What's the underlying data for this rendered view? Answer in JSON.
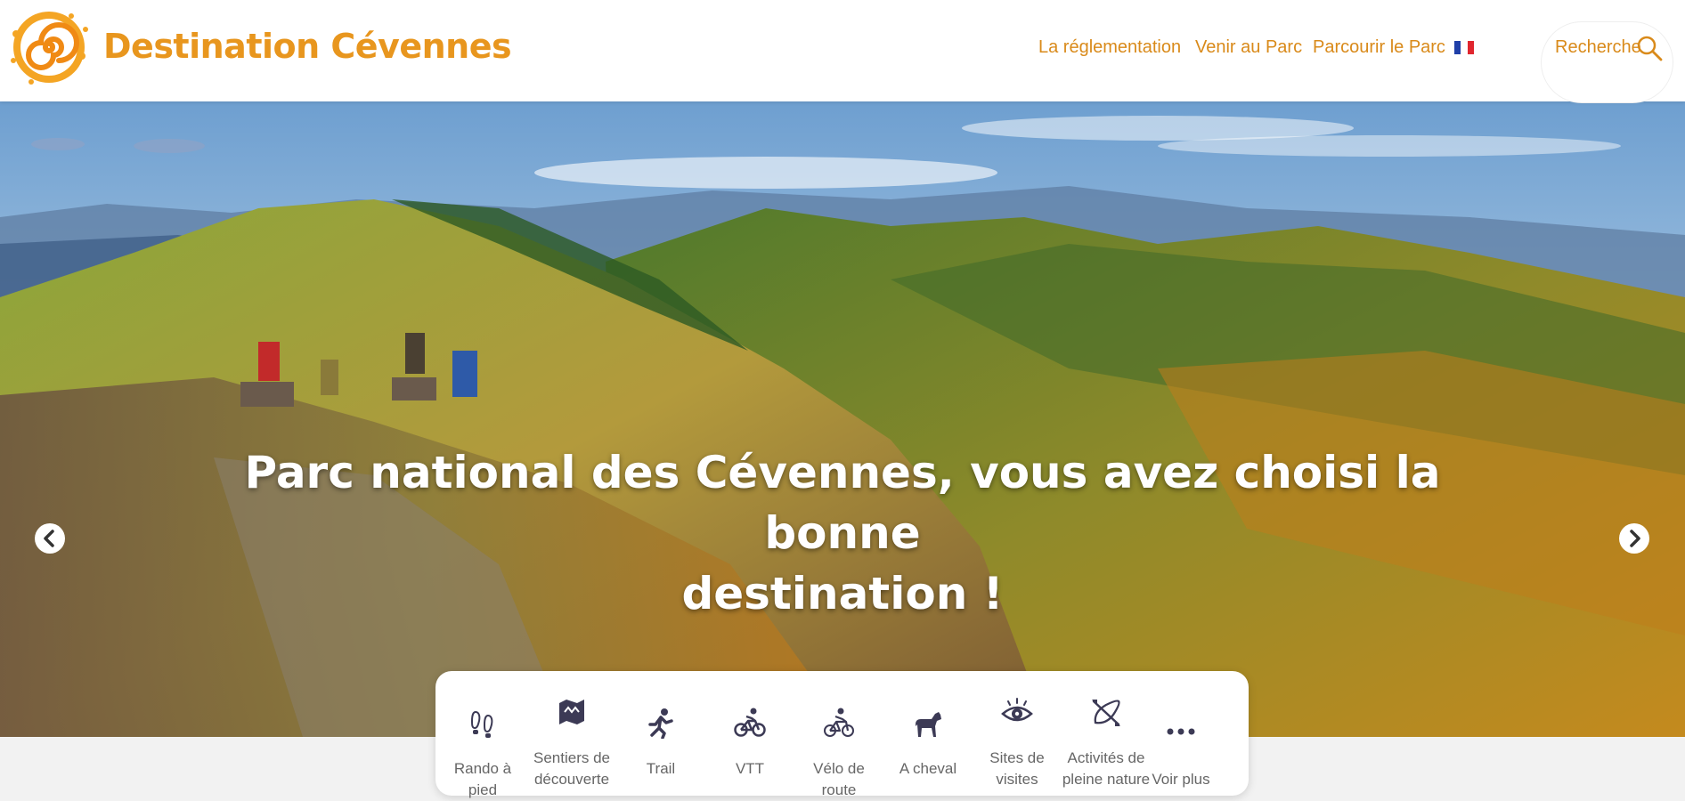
{
  "header": {
    "brand": "Destination Cévennes",
    "logo_icon": "spiral-sun-logo",
    "brand_color": "#e8961e",
    "nav": [
      {
        "label": "La réglementation"
      },
      {
        "label": "Venir au Parc"
      },
      {
        "label": "Parcourir le Parc"
      }
    ],
    "language_icon": "french-flag-icon",
    "search": {
      "label": "Recherche",
      "icon": "search-icon"
    }
  },
  "hero": {
    "title_line1": "Parc national des Cévennes, vous avez choisi la bonne",
    "title_line2": "destination !",
    "prev_icon": "chevron-left-icon",
    "next_icon": "chevron-right-icon"
  },
  "activities": [
    {
      "line1": "Rando à pied",
      "line2": "",
      "icon": "footprints-icon"
    },
    {
      "line1": "Sentiers de",
      "line2": "découverte",
      "icon": "map-icon"
    },
    {
      "line1": "Trail",
      "line2": "",
      "icon": "runner-icon"
    },
    {
      "line1": "VTT",
      "line2": "",
      "icon": "mountain-bike-icon"
    },
    {
      "line1": "Vélo de route",
      "line2": "",
      "icon": "road-bike-icon"
    },
    {
      "line1": "A cheval",
      "line2": "",
      "icon": "horse-icon"
    },
    {
      "line1": "Sites de",
      "line2": "visites",
      "icon": "eye-icon"
    },
    {
      "line1": "Activités de",
      "line2": "pleine nature",
      "icon": "kayak-icon"
    },
    {
      "line1": "Voir plus",
      "line2": "",
      "icon": "more-dots-icon"
    }
  ],
  "colors": {
    "accent": "#e8961e",
    "icon": "#3c3a55"
  }
}
